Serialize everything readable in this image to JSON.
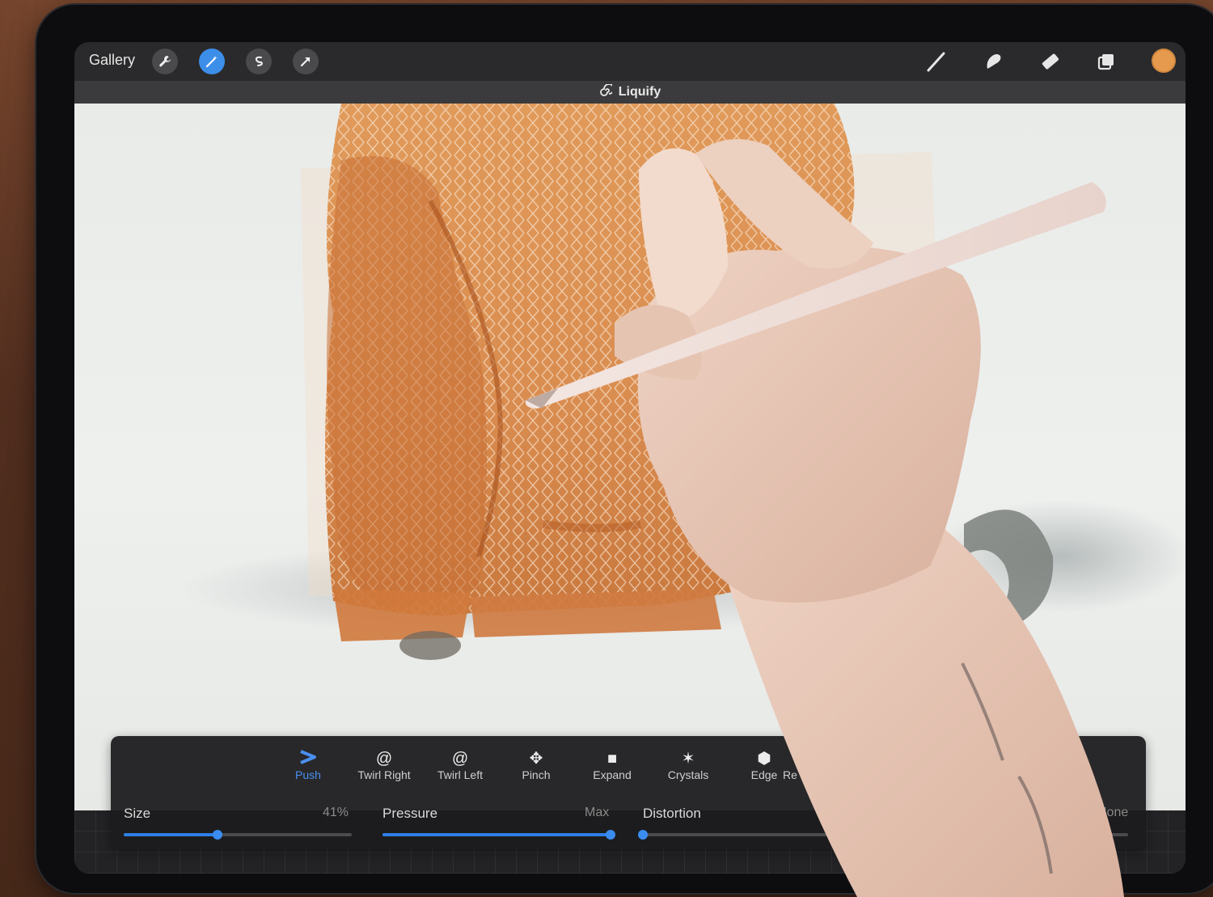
{
  "topbar": {
    "gallery_label": "Gallery",
    "left_tools": [
      "wrench-icon",
      "magic-wand-icon",
      "selection-icon",
      "transform-arrow-icon"
    ],
    "active_tool": "magic-wand-icon",
    "right_tools": [
      "brush-icon",
      "smudge-icon",
      "eraser-icon",
      "layers-icon"
    ],
    "color_swatch": "#e59a4e"
  },
  "mode_bar": {
    "title": "Liquify"
  },
  "liquify": {
    "modes": [
      {
        "label": "Push",
        "icon": "push-icon",
        "active": true
      },
      {
        "label": "Twirl Right",
        "icon": "twirl-right-icon",
        "active": false
      },
      {
        "label": "Twirl Left",
        "icon": "twirl-left-icon",
        "active": false
      },
      {
        "label": "Pinch",
        "icon": "pinch-icon",
        "active": false
      },
      {
        "label": "Expand",
        "icon": "expand-icon",
        "active": false
      },
      {
        "label": "Crystals",
        "icon": "crystals-icon",
        "active": false
      },
      {
        "label": "Edge",
        "icon": "edge-icon",
        "active": false
      },
      {
        "label": "Re",
        "icon": "reconstruct-icon",
        "active": false
      }
    ],
    "size": {
      "label": "Size",
      "value_text": "41%",
      "fraction": 0.41
    },
    "pressure": {
      "label": "Pressure",
      "value_text": "Max",
      "fraction": 1.0
    },
    "distortion": {
      "label": "Distortion",
      "value_text": "None",
      "fraction": 0.0
    }
  },
  "colors": {
    "accent": "#3c8ee8",
    "panel_bg": "#1c1c1e",
    "sweater": "#d98c4f"
  }
}
